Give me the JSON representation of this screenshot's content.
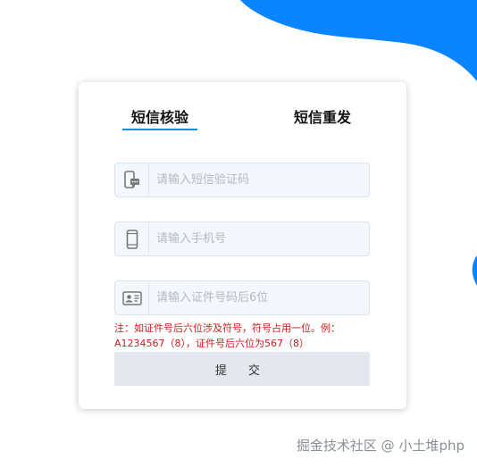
{
  "tabs": {
    "verify_label": "短信核验",
    "resend_label": "短信重发"
  },
  "fields": {
    "sms_code": {
      "placeholder": "请输入短信验证码",
      "icon": "sms-phone-icon"
    },
    "phone": {
      "placeholder": "请输入手机号",
      "icon": "mobile-phone-icon"
    },
    "id_number": {
      "placeholder": "请输入证件号码后6位",
      "icon": "id-card-icon"
    }
  },
  "note": "注：如证件号后六位涉及符号，符号占用一位。例：A1234567（8），证件号后六位为567（8）",
  "submit_label": "提 交",
  "watermark": "掘金技术社区 @ 小土堆php",
  "colors": {
    "accent": "#1a8fd6",
    "blob": "#0a84ff",
    "note_red": "#d01c1c",
    "submit_bg": "#e4e7ee"
  }
}
